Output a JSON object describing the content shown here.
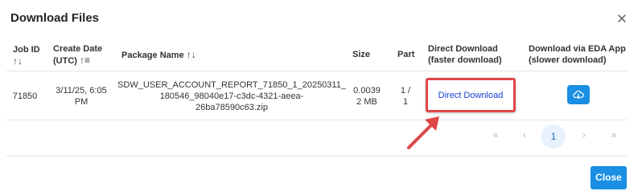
{
  "dialog": {
    "title": "Download Files",
    "close_label": "Close"
  },
  "table": {
    "headers": {
      "job_id_line1": "Job ID",
      "job_id_sort": "↑↓",
      "create_date_line1": "Create Date",
      "create_date_line2": "(UTC)",
      "create_date_sort": "↑≡",
      "package_name": "Package Name",
      "package_name_sort": "↑↓",
      "size": "Size",
      "part": "Part",
      "direct_line1": "Direct Download",
      "direct_line2": "(faster download)",
      "eda_line1": "Download via EDA App",
      "eda_line2": "(slower download)"
    },
    "rows": [
      {
        "job_id": "71850",
        "date_line1": "3/11/25, 6:05",
        "date_line2": "PM",
        "package_line1": "SDW_USER_ACCOUNT_REPORT_71850_1_20250311_",
        "package_line2": "180546_98040e17-c3dc-4321-aeea-",
        "package_line3": "26ba78590c63.zip",
        "size_line1": "0.0039",
        "size_line2": "2 MB",
        "part_line1": "1 /",
        "part_line2": "1",
        "direct_download_label": "Direct Download",
        "eda_icon": "cloud-download-icon"
      }
    ]
  },
  "pagination": {
    "first": "«",
    "prev": "‹",
    "current": "1",
    "next": "›",
    "last": "»"
  },
  "colors": {
    "accent": "#1a8fe3",
    "highlight": "#e04747",
    "link": "#1a3fd1"
  }
}
